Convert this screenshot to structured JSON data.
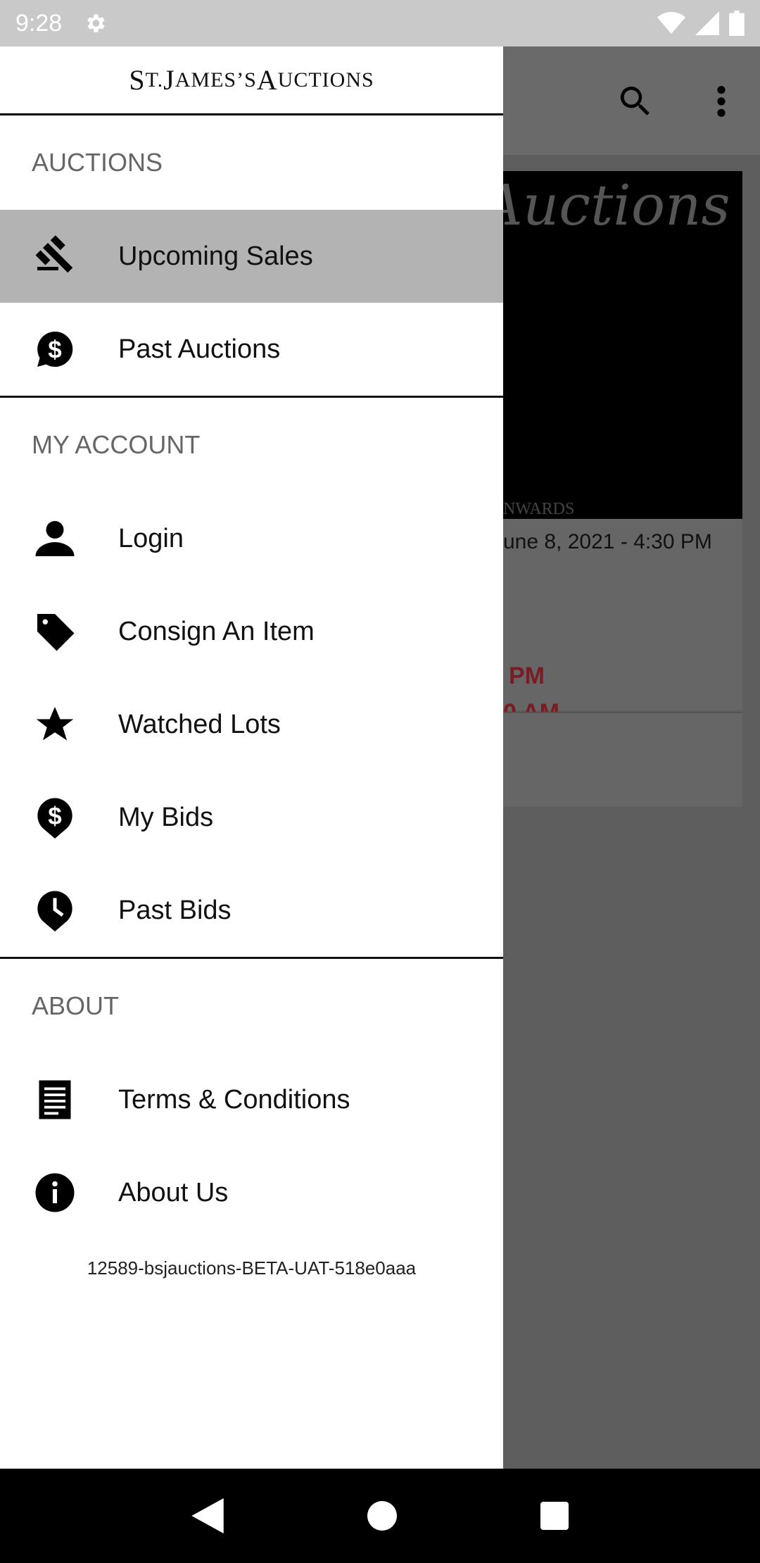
{
  "status_bar": {
    "time": "9:28",
    "icons": [
      "settings-icon",
      "wifi-icon",
      "signal-icon",
      "battery-icon"
    ]
  },
  "background": {
    "toolbar_icons": [
      "search-icon",
      "more-vert-icon"
    ],
    "card": {
      "image_text": "Auctions",
      "image_subtext": "NWARDS",
      "date": "une 8, 2021 - 4:30 PM",
      "red_line1": "PM",
      "red_line2": "0 AM"
    },
    "colors": {
      "accent_red": "#7a1c24"
    }
  },
  "drawer": {
    "logo_text": {
      "s1": "S",
      "s2": "T. ",
      "j": "J",
      "ames": "AMES’S ",
      "a": "A",
      "uctions": "UCTIONS"
    },
    "sections": [
      {
        "header": "AUCTIONS",
        "items": [
          {
            "label": "Upcoming Sales",
            "icon": "gavel-icon",
            "selected": true
          },
          {
            "label": "Past Auctions",
            "icon": "dollar-chat-icon"
          }
        ]
      },
      {
        "header": "MY ACCOUNT",
        "items": [
          {
            "label": "Login",
            "icon": "person-icon"
          },
          {
            "label": "Consign An Item",
            "icon": "tag-icon"
          },
          {
            "label": "Watched Lots",
            "icon": "star-icon"
          },
          {
            "label": "My Bids",
            "icon": "dollar-pin-icon"
          },
          {
            "label": "Past Bids",
            "icon": "clock-pin-icon"
          }
        ]
      },
      {
        "header": "ABOUT",
        "items": [
          {
            "label": "Terms & Conditions",
            "icon": "document-icon"
          },
          {
            "label": "About Us",
            "icon": "info-icon"
          }
        ]
      }
    ],
    "version": "12589-bsjauctions-BETA-UAT-518e0aaa"
  },
  "nav_bar": [
    "back-icon",
    "home-icon",
    "recents-icon"
  ]
}
